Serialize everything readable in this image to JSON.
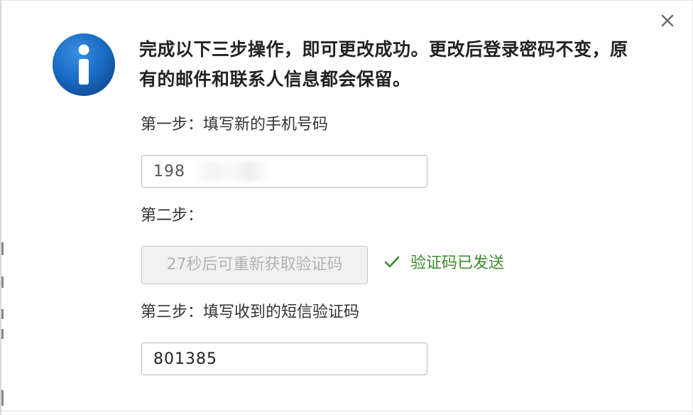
{
  "dialog": {
    "message": "完成以下三步操作，即可更改成功。更改后登录密码不变，原有的邮件和联系人信息都会保留。",
    "close_icon": "close-icon",
    "info_icon": "info-icon",
    "info_color": "#1565b8"
  },
  "step1": {
    "label": "第一步：填写新的手机号码",
    "phone_value": "198          3"
  },
  "step2": {
    "label": "第二步：",
    "resend_label": "27秒后可重新获取验证码",
    "status_icon": "check-icon",
    "status_text": "验证码已发送",
    "status_color": "#3f8a2e"
  },
  "step3": {
    "label": "第三步：填写收到的短信验证码",
    "code_value": "801385"
  }
}
